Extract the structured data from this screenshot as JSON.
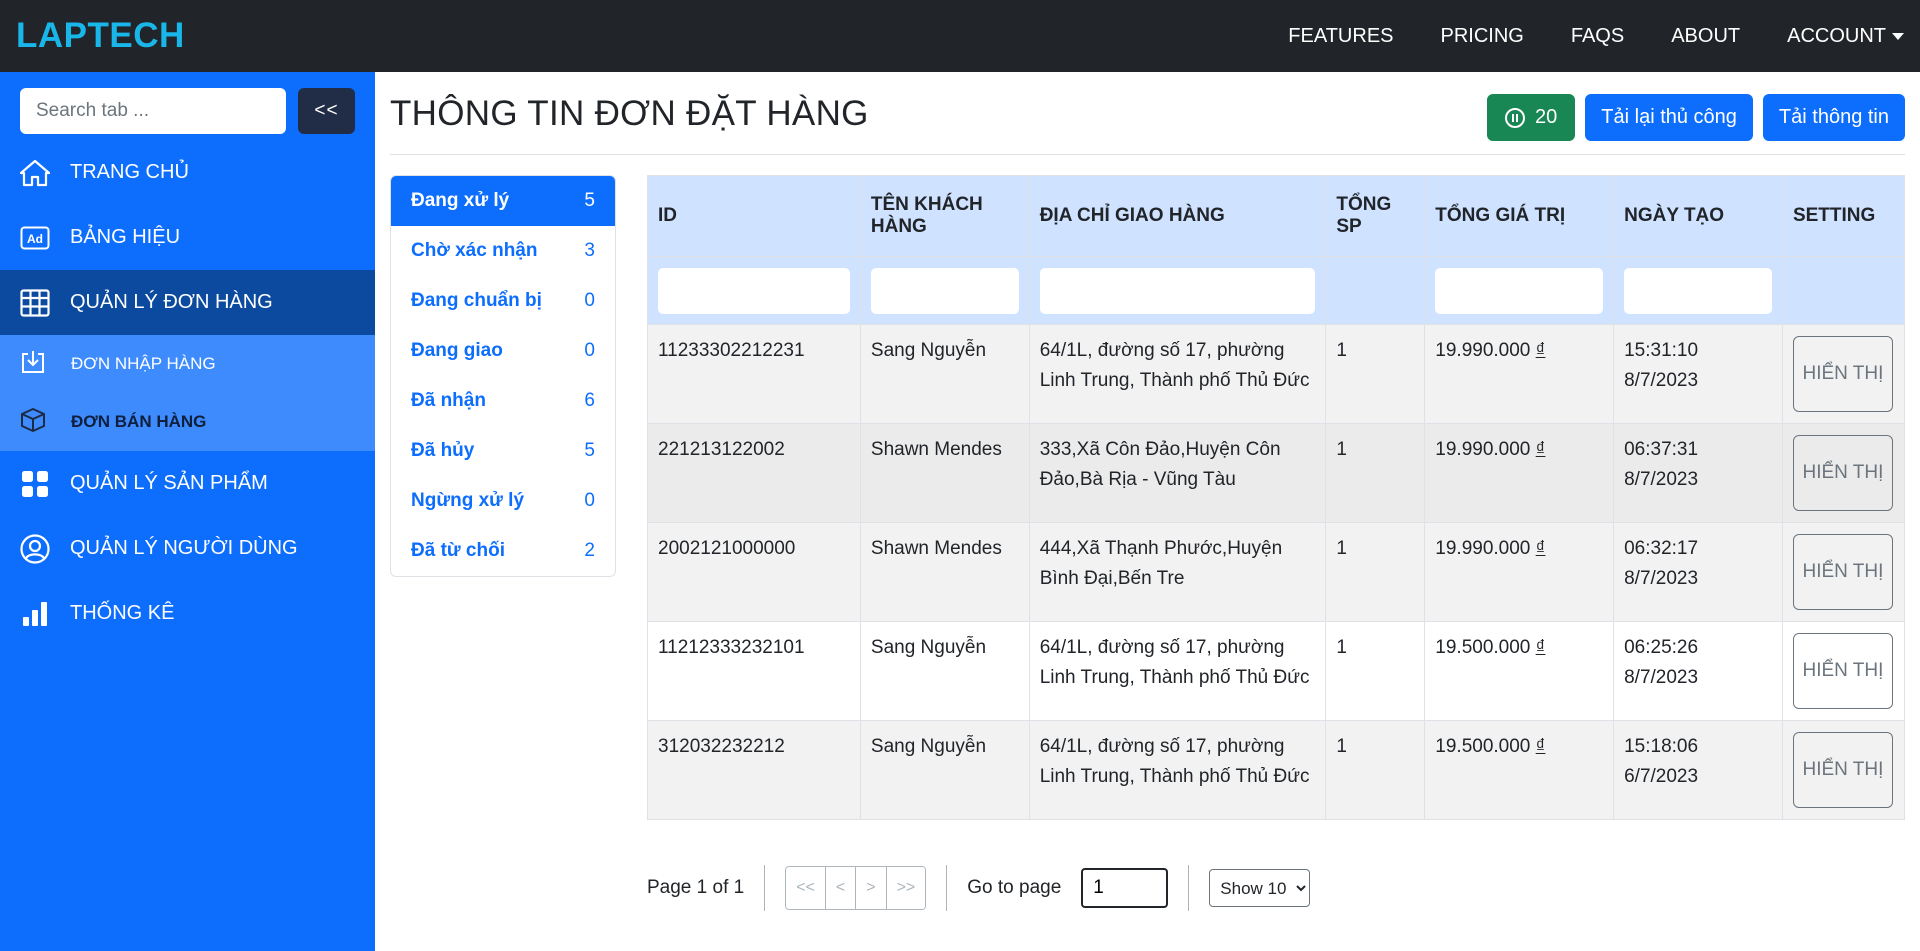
{
  "brand": "LAPTECH",
  "topnav": {
    "items": [
      "FEATURES",
      "PRICING",
      "FAQS",
      "ABOUT"
    ],
    "account": "ACCOUNT"
  },
  "sidebar": {
    "search_placeholder": "Search tab ...",
    "collapse_label": "<<",
    "items": [
      {
        "label": "TRANG CHỦ",
        "icon": "home-icon"
      },
      {
        "label": "BẢNG HIỆU",
        "icon": "ad-icon"
      },
      {
        "label": "QUẢN LÝ ĐƠN HÀNG",
        "icon": "table-icon"
      },
      {
        "label": "QUẢN LÝ SẢN PHẨM",
        "icon": "grid-icon"
      },
      {
        "label": "QUẢN LÝ NGƯỜI DÙNG",
        "icon": "user-circle-icon"
      },
      {
        "label": "THỐNG KÊ",
        "icon": "bar-chart-icon"
      }
    ],
    "subitems": [
      {
        "label": "ĐƠN NHẬP HÀNG",
        "icon": "download-tray-icon"
      },
      {
        "label": "ĐƠN BÁN HÀNG",
        "icon": "box-icon"
      }
    ]
  },
  "page": {
    "title": "THÔNG TIN ĐƠN ĐẶT HÀNG",
    "timer_value": "20",
    "reload_label": "Tải lại thủ công",
    "load_label": "Tải thông tin"
  },
  "statuses": [
    {
      "label": "Đang xử lý",
      "count": "5"
    },
    {
      "label": "Chờ xác nhận",
      "count": "3"
    },
    {
      "label": "Đang chuẩn bị",
      "count": "0"
    },
    {
      "label": "Đang giao",
      "count": "0"
    },
    {
      "label": "Đã nhận",
      "count": "6"
    },
    {
      "label": "Đã hủy",
      "count": "5"
    },
    {
      "label": "Ngừng xử lý",
      "count": "0"
    },
    {
      "label": "Đã từ chối",
      "count": "2"
    }
  ],
  "table": {
    "headers": [
      "ID",
      "TÊN KHÁCH HÀNG",
      "ĐỊA CHỈ GIAO HÀNG",
      "TỔNG SP",
      "TỔNG GIÁ TRỊ",
      "NGÀY TẠO",
      "SETTING"
    ],
    "show_label": "HIỂN THỊ",
    "currency": "₫",
    "rows": [
      {
        "id": "11233302212231",
        "customer": "Sang Nguyễn",
        "address": "64/1L, đường số 17, phường Linh Trung, Thành phố Thủ Đức",
        "qty": "1",
        "total": "19.990.000",
        "time": "15:31:10",
        "date": "8/7/2023"
      },
      {
        "id": "221213122002",
        "customer": "Shawn Mendes",
        "address": "333,Xã Côn Đảo,Huyện Côn Đảo,Bà Rịa - Vũng Tàu",
        "qty": "1",
        "total": "19.990.000",
        "time": "06:37:31",
        "date": "8/7/2023"
      },
      {
        "id": "2002121000000",
        "customer": "Shawn Mendes",
        "address": "444,Xã Thạnh Phước,Huyện Bình Đại,Bến Tre",
        "qty": "1",
        "total": "19.990.000",
        "time": "06:32:17",
        "date": "8/7/2023"
      },
      {
        "id": "11212333232101",
        "customer": "Sang Nguyễn",
        "address": "64/1L, đường số 17, phường Linh Trung, Thành phố Thủ Đức",
        "qty": "1",
        "total": "19.500.000",
        "time": "06:25:26",
        "date": "8/7/2023"
      },
      {
        "id": "312032232212",
        "customer": "Sang Nguyễn",
        "address": "64/1L, đường số 17, phường Linh Trung, Thành phố Thủ Đức",
        "qty": "1",
        "total": "19.500.000",
        "time": "15:18:06",
        "date": "6/7/2023"
      }
    ]
  },
  "pagination": {
    "page_info": "Page 1 of 1",
    "first": "<<",
    "prev": "<",
    "next": ">",
    "last": ">>",
    "goto_label": "Go to page",
    "goto_value": "1",
    "show_selected": "Show 10"
  }
}
